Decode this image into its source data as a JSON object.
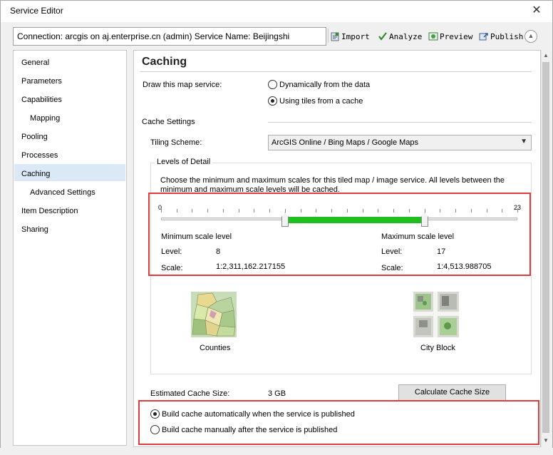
{
  "window": {
    "title": "Service Editor"
  },
  "toolbar": {
    "connection_text": "Connection: arcgis on aj.enterprise.cn (admin)   Service Name: Beijingshi",
    "import_label": "Import",
    "analyze_label": "Analyze",
    "preview_label": "Preview",
    "publish_label": "Publish"
  },
  "sidebar": {
    "items": [
      {
        "label": "General"
      },
      {
        "label": "Parameters"
      },
      {
        "label": "Capabilities"
      },
      {
        "label": "Mapping"
      },
      {
        "label": "Pooling"
      },
      {
        "label": "Processes"
      },
      {
        "label": "Caching"
      },
      {
        "label": "Advanced Settings"
      },
      {
        "label": "Item Description"
      },
      {
        "label": "Sharing"
      }
    ],
    "selected": "Caching"
  },
  "caching": {
    "heading": "Caching",
    "draw_label": "Draw this map service:",
    "option_dynamic": "Dynamically from the data",
    "option_tiles": "Using tiles from a cache",
    "option_selected": "Using tiles from a cache",
    "cache_settings_label": "Cache Settings",
    "tiling_scheme_label": "Tiling Scheme:",
    "tiling_scheme_value": "ArcGIS Online / Bing Maps / Google Maps",
    "lod": {
      "legend": "Levels of Detail",
      "description": "Choose the minimum and maximum scales for this tiled map / image service. All levels between the minimum and maximum scale levels will be cached.",
      "min_tick": "0",
      "max_tick": "23",
      "range_min": 0,
      "range_max": 23,
      "min_header": "Minimum scale level",
      "max_header": "Maximum scale level",
      "level_label": "Level:",
      "scale_label": "Scale:",
      "min_level": "8",
      "max_level": "17",
      "min_scale": "1:2,311,162.217155",
      "max_scale": "1:4,513.988705",
      "min_thumb_label": "Counties",
      "max_thumb_label": "City Block"
    },
    "estimated_label": "Estimated Cache Size:",
    "estimated_value": "3 GB",
    "calc_button": "Calculate Cache Size",
    "build_auto": "Build cache automatically when the service is published",
    "build_manual": "Build cache manually after the service is published",
    "build_selected": "Build cache automatically when the service is published"
  },
  "colors": {
    "accent_green": "#1fbf1f",
    "highlight_red": "#e03c3c",
    "selection_blue": "#dbe8f6"
  },
  "icons": {
    "close": "close-icon",
    "import": "import-icon",
    "analyze": "checkmark-icon",
    "preview": "preview-icon",
    "publish": "publish-icon",
    "collapse": "chevron-up-icon"
  }
}
